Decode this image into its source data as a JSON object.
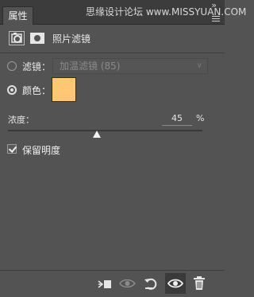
{
  "panel": {
    "tab_label": "属性",
    "watermark_text": "思缘设计论坛 www.MISSYUAN.COM"
  },
  "header": {
    "adjustment_label": "照片滤镜"
  },
  "filter_row": {
    "label": "滤镜：",
    "selected": "加温滤镜 (85)",
    "enabled": false
  },
  "color_row": {
    "label": "颜色：",
    "swatch_color": "#ffc673",
    "selected": true
  },
  "density": {
    "label": "浓度：",
    "value": "45",
    "unit": "%"
  },
  "preserve_luminosity": {
    "label": "保留明度",
    "checked": true
  },
  "bottom_toolbar": {
    "icons": [
      "clip-to-layer-icon",
      "toggle-previous-state-icon",
      "reset-icon",
      "visibility-eye-icon",
      "delete-trash-icon"
    ]
  },
  "colors": {
    "panel_bg": "#535353",
    "titlebar_bg": "#3c3c3c",
    "accent_swatch": "#ffc673"
  }
}
